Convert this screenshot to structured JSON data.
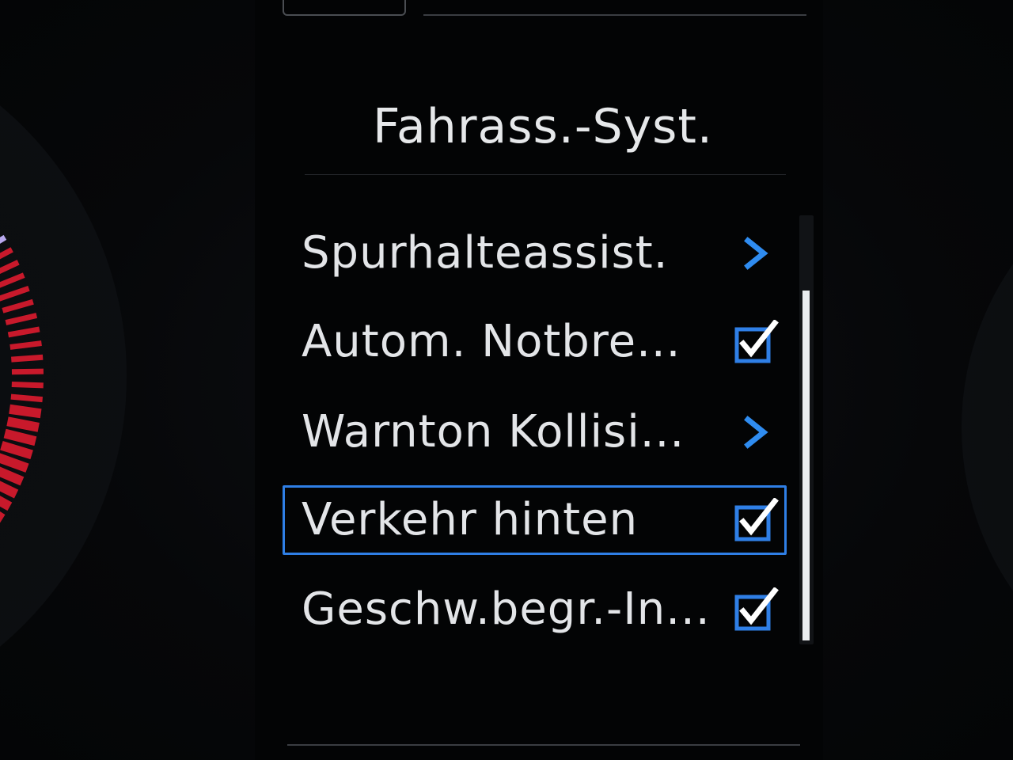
{
  "menu": {
    "title": "Fahrass.-Syst.",
    "items": [
      {
        "label": "Spurhalteassist.",
        "control": "chevron-icon"
      },
      {
        "label": "Autom. Notbre...",
        "control": "checkbox-icon",
        "checked": true
      },
      {
        "label": "Warnton Kollisi...",
        "control": "chevron-icon"
      },
      {
        "label": "Verkehr hinten",
        "control": "checkbox-icon",
        "checked": true,
        "selected": true
      },
      {
        "label": "Geschw.begr.-In...",
        "control": "checkbox-icon",
        "checked": true
      }
    ]
  },
  "colors": {
    "accent": "#2f7fe6",
    "text": "#e3e5e8",
    "background": "#030405",
    "gauge_red": "#c8192b",
    "gauge_lilac": "#b8a8ee"
  }
}
